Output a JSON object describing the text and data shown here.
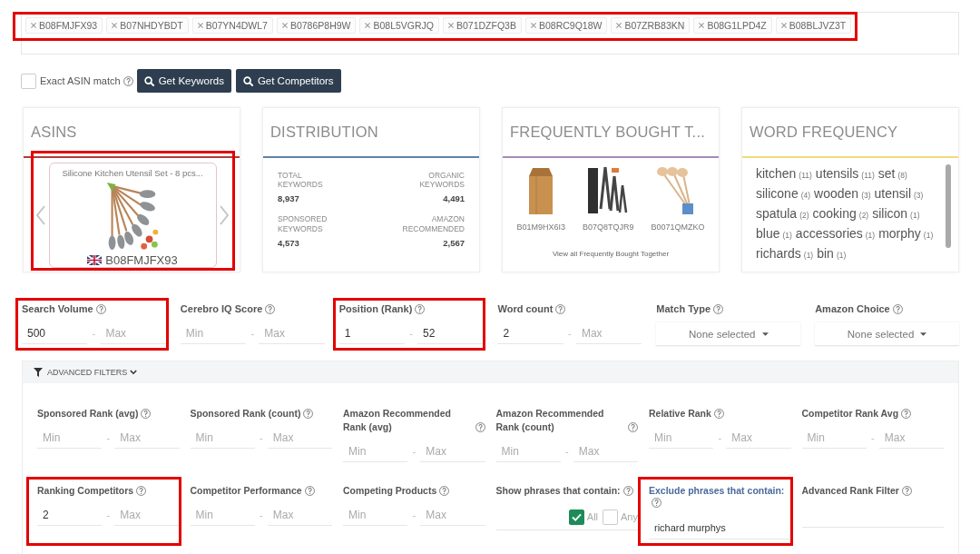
{
  "asin_tags": {
    "highlighted": true,
    "tags": [
      "B08FMJFX93",
      "B07NHDYBDT",
      "B07YN4DWL7",
      "B0786P8H9W",
      "B08L5VGRJQ",
      "B071DZFQ3B",
      "B08RC9Q18W",
      "B07ZRB83KN",
      "B08G1LPD4Z",
      "B08BLJVZ3T"
    ]
  },
  "exact_match": {
    "label": "Exact ASIN match",
    "checked": false
  },
  "buttons": [
    {
      "label": "Get Keywords"
    },
    {
      "label": "Get Competitors"
    }
  ],
  "cards": [
    {
      "kind": "asins",
      "title": "ASINS",
      "color": "#b33a3a",
      "product": {
        "title": "Silicone Kitchen Utensil Set - 8 pcs...",
        "asin": "B08FMJFX93",
        "highlighted": true
      }
    },
    {
      "kind": "distribution",
      "title": "DISTRIBUTION",
      "color": "#5d83a8",
      "stats": [
        {
          "label": "TOTAL KEYWORDS",
          "value": "8,937"
        },
        {
          "label": "ORGANIC KEYWORDS",
          "value": "4,491"
        },
        {
          "label": "SPONSORED KEYWORDS",
          "value": "4,573"
        },
        {
          "label": "AMAZON RECOMMENDED",
          "value": "2,567"
        }
      ]
    },
    {
      "kind": "bought_together",
      "title": "FREQUENTLY BOUGHT T...",
      "color": "#a58bb5",
      "items": [
        {
          "asin": "B01M9HX6I3"
        },
        {
          "asin": "B07Q8TQJR9"
        },
        {
          "asin": "B0071QMZKO"
        }
      ],
      "link": "View all Frequently Bought Together"
    },
    {
      "kind": "word_frequency",
      "title": "WORD FREQUENCY",
      "color": "#f2d97a",
      "words": [
        {
          "word": "kitchen",
          "count": "(11)"
        },
        {
          "word": "utensils",
          "count": "(11)"
        },
        {
          "word": "set",
          "count": "(8)"
        },
        {
          "word": "silicone",
          "count": "(4)"
        },
        {
          "word": "wooden",
          "count": "(3)"
        },
        {
          "word": "utensil",
          "count": "(3)"
        },
        {
          "word": "spatula",
          "count": "(2)"
        },
        {
          "word": "cooking",
          "count": "(2)"
        },
        {
          "word": "silicon",
          "count": "(1)"
        },
        {
          "word": "blue",
          "count": "(1)"
        },
        {
          "word": "accessories",
          "count": "(1)"
        },
        {
          "word": "morphy",
          "count": "(1)"
        },
        {
          "word": "richards",
          "count": "(1)"
        },
        {
          "word": "bin",
          "count": "(1)"
        }
      ]
    }
  ],
  "filters": [
    {
      "kind": "range",
      "label": "Search Volume",
      "highlighted": true,
      "min": {
        "value": "500"
      },
      "separator": "-",
      "max": {
        "placeholder": "Max"
      }
    },
    {
      "kind": "range",
      "label": "Cerebro IQ Score",
      "highlighted": false,
      "min": {
        "placeholder": "Min"
      },
      "separator": "-",
      "max": {
        "placeholder": "Max"
      }
    },
    {
      "kind": "range",
      "label": "Position (Rank)",
      "highlighted": true,
      "min": {
        "value": "1"
      },
      "separator": "-",
      "max": {
        "value": "52"
      }
    },
    {
      "kind": "range",
      "label": "Word count",
      "highlighted": false,
      "min": {
        "value": "2"
      },
      "separator": "-",
      "max": {
        "placeholder": "Max"
      }
    },
    {
      "kind": "dropdown",
      "label": "Match Type",
      "highlighted": false,
      "value": "None selected"
    },
    {
      "kind": "dropdown",
      "label": "Amazon Choice",
      "highlighted": false,
      "value": "None selected"
    }
  ],
  "advanced_filters": {
    "label": "ADVANCED FILTERS",
    "expanded": true,
    "filters": [
      {
        "kind": "range",
        "label": "Sponsored Rank (avg)",
        "highlighted": false,
        "focused": false,
        "min": {
          "placeholder": "Min"
        },
        "separator": "-",
        "max": {
          "placeholder": "Max"
        }
      },
      {
        "kind": "range",
        "label": "Sponsored Rank (count)",
        "highlighted": false,
        "focused": false,
        "min": {
          "placeholder": "Min"
        },
        "separator": "-",
        "max": {
          "placeholder": "Max"
        }
      },
      {
        "kind": "range",
        "label": "Amazon Recommended Rank (avg)",
        "highlighted": false,
        "focused": false,
        "min": {
          "placeholder": "Min"
        },
        "separator": "-",
        "max": {
          "placeholder": "Max"
        }
      },
      {
        "kind": "range",
        "label": "Amazon Recommended Rank (count)",
        "highlighted": false,
        "focused": false,
        "min": {
          "placeholder": "Min"
        },
        "separator": "-",
        "max": {
          "placeholder": "Max"
        }
      },
      {
        "kind": "range",
        "label": "Relative Rank",
        "highlighted": false,
        "focused": false,
        "min": {
          "placeholder": "Min"
        },
        "separator": "-",
        "max": {
          "placeholder": "Max"
        }
      },
      {
        "kind": "range",
        "label": "Competitor Rank Avg",
        "highlighted": false,
        "focused": false,
        "min": {
          "placeholder": "Min"
        },
        "separator": "-",
        "max": {
          "placeholder": "Max"
        }
      },
      {
        "kind": "range",
        "label": "Ranking Competitors",
        "highlighted": true,
        "focused": false,
        "min": {
          "value": "2"
        },
        "separator": "-",
        "max": {
          "placeholder": "Max"
        }
      },
      {
        "kind": "range",
        "label": "Competitor Performance",
        "highlighted": false,
        "focused": false,
        "min": {
          "placeholder": "Min"
        },
        "separator": "-",
        "max": {
          "placeholder": "Max"
        }
      },
      {
        "kind": "range",
        "label": "Competing Products",
        "highlighted": false,
        "focused": false,
        "min": {
          "placeholder": "Min"
        },
        "separator": "-",
        "max": {
          "placeholder": "Max"
        }
      },
      {
        "kind": "phrase_match",
        "label": "Show phrases that contain:",
        "highlighted": false,
        "focused": false,
        "options": [
          {
            "label": "All",
            "checked": true
          },
          {
            "label": "Any",
            "checked": false
          }
        ]
      },
      {
        "kind": "text",
        "label": "Exclude phrases that contain:",
        "highlighted": true,
        "focused": true,
        "value": "richard murphys"
      },
      {
        "kind": "text",
        "label": "Advanced Rank Filter",
        "highlighted": false,
        "focused": false
      }
    ]
  }
}
